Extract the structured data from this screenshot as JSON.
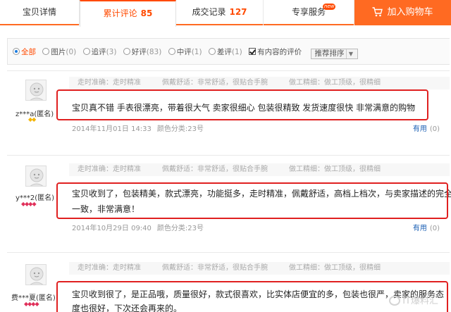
{
  "tabs": [
    {
      "label": "宝贝详情",
      "count": ""
    },
    {
      "label": "累计评论",
      "count": "85"
    },
    {
      "label": "成交记录",
      "count": "127"
    },
    {
      "label": "专享服务",
      "count": "",
      "badge": "new"
    }
  ],
  "cart_label": "加入购物车",
  "filters": {
    "all": {
      "label": "全部"
    },
    "pic": {
      "label": "图片",
      "count": "(0)"
    },
    "add": {
      "label": "追评",
      "count": "(3)"
    },
    "good": {
      "label": "好评",
      "count": "(83)"
    },
    "mid": {
      "label": "中评",
      "count": "(1)"
    },
    "bad": {
      "label": "差评",
      "count": "(1)"
    },
    "has_content": "有内容的评价",
    "sort": "推荐排序"
  },
  "reviews": [
    {
      "user": "z***a(匿名)",
      "gems": "◆◆",
      "tags": [
        "走时准确：走时精准",
        "佩戴舒适：非常舒适，很贴合手腕",
        "做工精细：做工顶级，很精细"
      ],
      "lines": [
        "宝贝真不错 手表很漂亮，带着很大气 卖家很细心 包装很精致 发货速度很快 非常满意的购物"
      ],
      "date": "2014年11月01日 14:33",
      "sku": "颜色分类:23号",
      "useful": "有用",
      "useful_count": "(0)"
    },
    {
      "user": "y***2(匿名)",
      "gems": "◆◆◆◆",
      "tags": [
        "走时准确：走时精准",
        "佩戴舒适：非常舒适，很贴合手腕",
        "做工精细：做工顶级，很精细"
      ],
      "lines": [
        "宝贝收到了，包装精美，款式漂亮，功能挺多，走时精准，佩戴舒适，高档上档次，与卖家描述的完全",
        "一致，非常满意！"
      ],
      "date": "2014年10月29日 09:40",
      "sku": "颜色分类:23号",
      "useful": "有用",
      "useful_count": "(0)"
    },
    {
      "user": "费***夏(匿名)",
      "gems": "◆◆◆◆",
      "tags": [
        "走时准确：走时精准",
        "佩戴舒适：非常舒适，很贴合手腕",
        "做工精细：做工顶级，很精细"
      ],
      "lines": [
        "宝贝收到很了，是正品哦，质量很好，款式很喜欢，比实体店便宜的多，包装也很严，卖家的服务态",
        "度也很好，下次还会再来的。"
      ],
      "date": "",
      "sku": "",
      "useful": "",
      "useful_count": ""
    }
  ],
  "watermark": "IT爆料汇",
  "colors": {
    "accent": "#ff6a22",
    "highlight_box": "#e02020",
    "link": "#1a5fb4"
  }
}
